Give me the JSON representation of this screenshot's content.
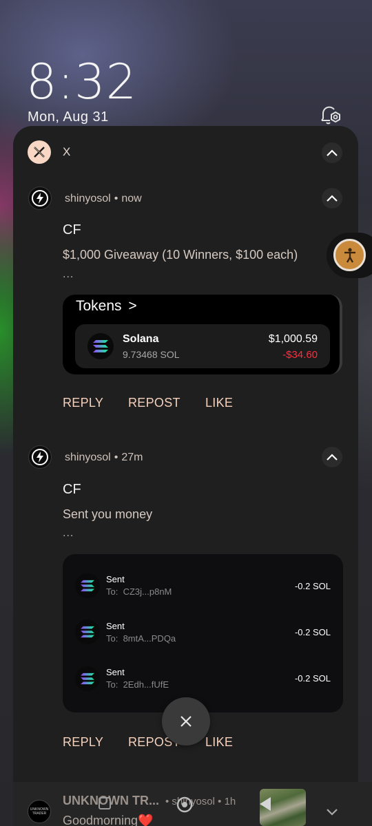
{
  "lockscreen": {
    "time": "8:32",
    "date": "Mon, Aug 31"
  },
  "app_group": {
    "app_name": "X",
    "icon": "x-logo-icon"
  },
  "notifications": [
    {
      "author": "shinyosol",
      "time": "now",
      "title": "CF",
      "body": "$1,000 Giveaway (10 Winners, $100 each)",
      "ellipsis": "...",
      "card": {
        "heading": "Tokens",
        "heading_chevron": ">",
        "token": {
          "name": "Solana",
          "amount": "9.73468 SOL",
          "value": "$1,000.59",
          "change": "-$34.60"
        }
      },
      "actions": [
        "REPLY",
        "REPOST",
        "LIKE"
      ]
    },
    {
      "author": "shinyosol",
      "time": "27m",
      "title": "CF",
      "body": "Sent you money",
      "ellipsis": "...",
      "transactions": [
        {
          "label": "Sent",
          "to_prefix": "To:",
          "to": "CZ3j...p8nM",
          "amount": "-0.2 SOL"
        },
        {
          "label": "Sent",
          "to_prefix": "To:",
          "to": "8mtA...PDQa",
          "amount": "-0.2 SOL"
        },
        {
          "label": "Sent",
          "to_prefix": "To:",
          "to": "2Edh...fUfE",
          "amount": "-0.2 SOL"
        }
      ],
      "actions": [
        "REPLY",
        "REPOST",
        "LIKE"
      ]
    }
  ],
  "bottom_notification": {
    "app": "UNKNOWN TR...",
    "avatar_text": "UNKNOWN TRADER",
    "author": "shinyosol",
    "time": "1h",
    "text": "Goodmorning❤️"
  },
  "colors": {
    "accent": "#f6d2bd",
    "negative": "#ff2d3f",
    "panel": "#1f1f1f"
  }
}
